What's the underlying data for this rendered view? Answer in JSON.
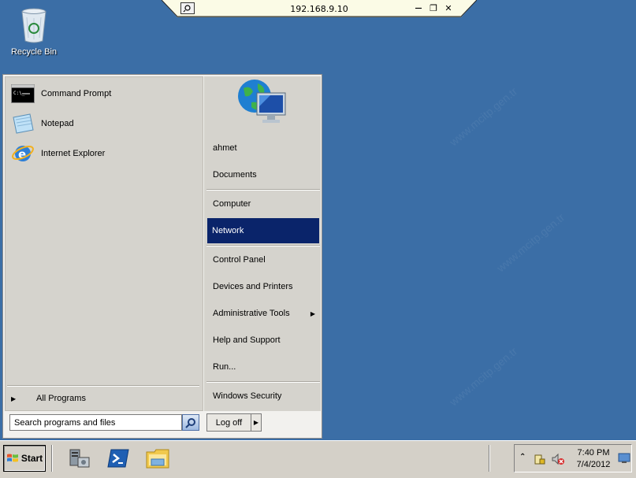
{
  "remote_bar": {
    "title": "192.168.9.10",
    "pin_icon": "pin-icon",
    "minimize_label": "—",
    "restore_label": "❐",
    "close_label": "✕"
  },
  "desktop": {
    "recycle_bin_label": "Recycle Bin"
  },
  "start_menu": {
    "programs": [
      {
        "label": "Command Prompt",
        "icon": "command-prompt-icon"
      },
      {
        "label": "Notepad",
        "icon": "notepad-icon"
      },
      {
        "label": "Internet Explorer",
        "icon": "internet-explorer-icon"
      }
    ],
    "all_programs_label": "All Programs",
    "search_placeholder": "Search programs and files",
    "right_items": {
      "user": "ahmet",
      "documents": "Documents",
      "computer": "Computer",
      "network": "Network",
      "control_panel": "Control Panel",
      "devices_printers": "Devices and Printers",
      "admin_tools": "Administrative Tools",
      "help_support": "Help and Support",
      "run": "Run...",
      "windows_security": "Windows Security"
    },
    "selected_item": "Network",
    "logoff_label": "Log off"
  },
  "taskbar": {
    "start_label": "Start",
    "pinned": [
      "server-manager-icon",
      "powershell-icon",
      "windows-explorer-icon"
    ],
    "clock_time": "7:40 PM",
    "clock_date": "7/4/2012"
  },
  "colors": {
    "desktop": "#3a6ea5",
    "selection": "#0a246a",
    "menu_bg": "#d5d3cd"
  }
}
